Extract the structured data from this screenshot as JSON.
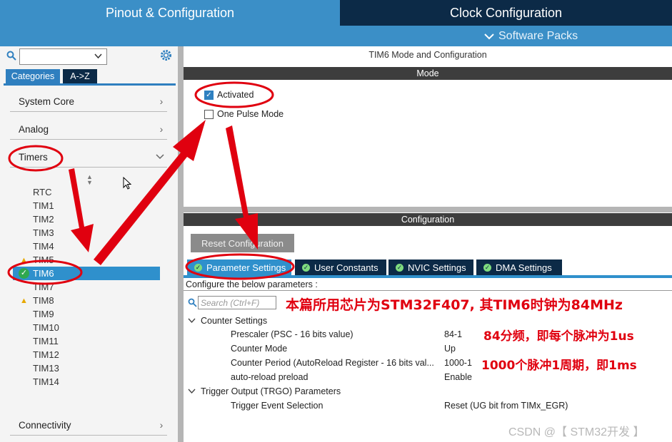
{
  "header": {
    "tab_pinout": "Pinout & Configuration",
    "tab_clock": "Clock Configuration",
    "software_packs": "Software Packs"
  },
  "sidebar": {
    "search_value": "",
    "tab_categories": "Categories",
    "tab_az": "A->Z",
    "groups": {
      "system_core": "System Core",
      "analog": "Analog",
      "timers": "Timers",
      "connectivity": "Connectivity"
    },
    "timer_items": [
      "RTC",
      "TIM1",
      "TIM2",
      "TIM3",
      "TIM4",
      "TIM5",
      "TIM6",
      "TIM7",
      "TIM8",
      "TIM9",
      "TIM10",
      "TIM11",
      "TIM12",
      "TIM13",
      "TIM14"
    ],
    "selected_item": "TIM6"
  },
  "main": {
    "title": "TIM6 Mode and Configuration",
    "mode_header": "Mode",
    "activated_label": "Activated",
    "activated_checked": true,
    "one_pulse_label": "One Pulse Mode",
    "one_pulse_checked": false,
    "config_header": "Configuration",
    "reset_button": "Reset Configuration",
    "tabs": [
      "Parameter Settings",
      "User Constants",
      "NVIC Settings",
      "DMA Settings"
    ],
    "configure_text": "Configure the below parameters :",
    "search_placeholder": "Search (Ctrl+F)",
    "sections": {
      "counter": "Counter Settings",
      "trigger": "Trigger Output (TRGO) Parameters"
    },
    "params": [
      {
        "name": "Prescaler (PSC - 16 bits value)",
        "value": "84-1"
      },
      {
        "name": "Counter Mode",
        "value": "Up"
      },
      {
        "name": "Counter Period (AutoReload Register - 16 bits val...",
        "value": "1000-1"
      },
      {
        "name": "auto-reload preload",
        "value": "Enable"
      }
    ],
    "trigger_param": {
      "name": "Trigger Event Selection",
      "value": "Reset (UG bit from TIMx_EGR)"
    }
  },
  "annotations": {
    "line1": "本篇所用芯片为STM32F407, 其TIM6时钟为84MHz",
    "line2": "84分频，即每个脉冲为1us",
    "line3": "1000个脉冲1周期，即1ms"
  },
  "watermark": "CSDN @【 STM32开发 】",
  "colors": {
    "accent_blue": "#3b8fc7",
    "dark_navy": "#0c2a47",
    "annotation_red": "#e0000f"
  }
}
